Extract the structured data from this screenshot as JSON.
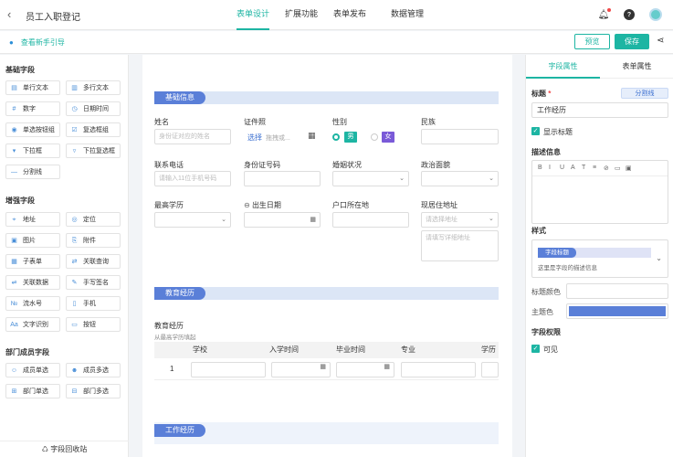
{
  "header": {
    "title": "员工入职登记",
    "tabs": [
      "表单设计",
      "扩展功能",
      "表单发布",
      "数据管理"
    ],
    "active_tab": "表单设计"
  },
  "subbar": {
    "guide": "查看新手引导",
    "preview": "预览",
    "save": "保存"
  },
  "left": {
    "basic_title": "基础字段",
    "basic": [
      {
        "label": "单行文本",
        "icon": "single-line-icon"
      },
      {
        "label": "多行文本",
        "icon": "multi-line-icon"
      },
      {
        "label": "数字",
        "icon": "number-icon"
      },
      {
        "label": "日期时间",
        "icon": "datetime-icon"
      },
      {
        "label": "单选按钮组",
        "icon": "radio-icon"
      },
      {
        "label": "复选框组",
        "icon": "checkbox-icon"
      },
      {
        "label": "下拉框",
        "icon": "dropdown-icon"
      },
      {
        "label": "下拉复选框",
        "icon": "dropdown-multi-icon"
      },
      {
        "label": "分割线",
        "icon": "divider-icon"
      }
    ],
    "enhanced_title": "增强字段",
    "enhanced": [
      {
        "label": "地址",
        "icon": "address-icon"
      },
      {
        "label": "定位",
        "icon": "location-icon"
      },
      {
        "label": "图片",
        "icon": "image-icon"
      },
      {
        "label": "附件",
        "icon": "attachment-icon"
      },
      {
        "label": "子表单",
        "icon": "subform-icon"
      },
      {
        "label": "关联查询",
        "icon": "related-query-icon"
      },
      {
        "label": "关联数据",
        "icon": "related-data-icon"
      },
      {
        "label": "手写签名",
        "icon": "signature-icon"
      },
      {
        "label": "流水号",
        "icon": "serial-icon"
      },
      {
        "label": "手机",
        "icon": "phone-icon"
      },
      {
        "label": "文字识别",
        "icon": "ocr-icon"
      },
      {
        "label": "按钮",
        "icon": "button-icon"
      }
    ],
    "dept_title": "部门成员字段",
    "dept": [
      {
        "label": "成员单选",
        "icon": "member-single-icon"
      },
      {
        "label": "成员多选",
        "icon": "member-multi-icon"
      },
      {
        "label": "部门单选",
        "icon": "dept-single-icon"
      },
      {
        "label": "部门多选",
        "icon": "dept-multi-icon"
      }
    ],
    "recycle": "字段回收站"
  },
  "form": {
    "section_basic": "基础信息",
    "name_label": "姓名",
    "name_placeholder": "身份证对应的姓名",
    "cert_label": "证件照",
    "cert_select": "选择",
    "cert_hint": "拖拽或...",
    "gender_label": "性别",
    "gender_male": "男",
    "gender_female": "女",
    "ethnic_label": "民族",
    "phone_label": "联系电话",
    "phone_placeholder": "请输入11位手机号码",
    "id_label": "身份证号码",
    "marital_label": "婚姻状况",
    "political_label": "政治面貌",
    "edu_label": "最高学历",
    "birth_label": "出生日期",
    "hukou_label": "户口所在地",
    "address_label": "现居住地址",
    "address_placeholder": "请选择地址",
    "address_detail_placeholder": "请填写详细地址",
    "section_edu": "教育经历",
    "edu_table_label": "教育经历",
    "edu_table_sub": "从最高学历填起",
    "edu_columns": [
      "学校",
      "入学时间",
      "毕业时间",
      "专业",
      "学历"
    ],
    "edu_row_index": "1",
    "section_work": "工作经历"
  },
  "right": {
    "tabs": [
      "字段属性",
      "表单属性"
    ],
    "title_label": "标题",
    "divider_btn": "分割线",
    "title_value": "工作经历",
    "show_title": "显示标题",
    "desc_label": "描述信息",
    "editor_tools": [
      "B",
      "I",
      "U",
      "A",
      "T",
      "≡",
      "⊘",
      "▭",
      "▣"
    ],
    "style_label": "样式",
    "style_tag": "字段标题",
    "style_desc": "这里是字段的描述信息",
    "title_color_label": "标题颜色",
    "theme_color_label": "主题色",
    "theme_color": "#5a7fd8",
    "perm_label": "字段权限",
    "visible": "可见"
  }
}
